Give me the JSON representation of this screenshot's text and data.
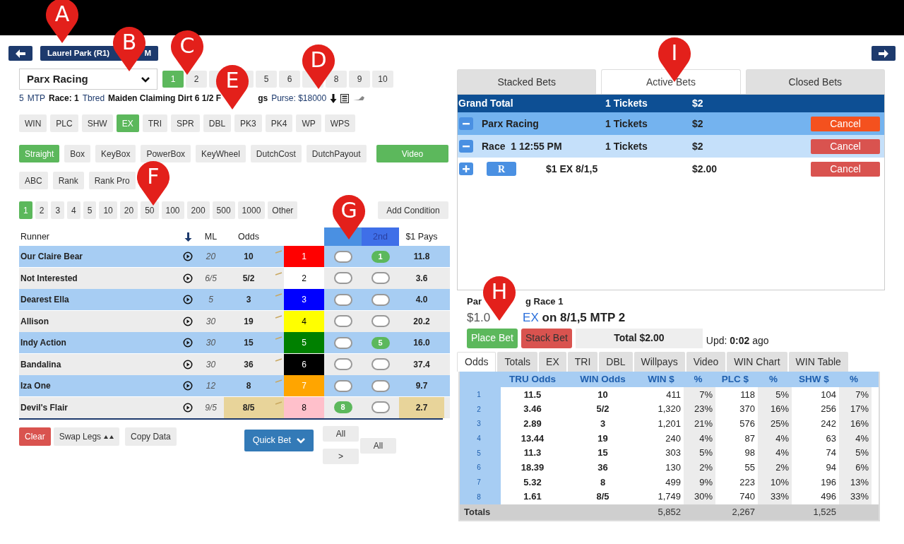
{
  "callouts": [
    {
      "letter": "A"
    },
    {
      "letter": "B"
    },
    {
      "letter": "C"
    },
    {
      "letter": "D"
    },
    {
      "letter": "E"
    },
    {
      "letter": "F"
    },
    {
      "letter": "G"
    },
    {
      "letter": "H"
    },
    {
      "letter": "I"
    }
  ],
  "race_button": {
    "label": "Laurel Park (R1)",
    "tail": "M"
  },
  "track_select": {
    "value": "Parx Racing"
  },
  "races": [
    {
      "kind": "number",
      "label": "1",
      "selected": true
    },
    {
      "kind": "number",
      "label": "2",
      "selected": false
    },
    {
      "kind": "covered",
      "selected": false
    },
    {
      "kind": "covered",
      "selected": false
    },
    {
      "kind": "number",
      "label": "5",
      "selected": false
    },
    {
      "kind": "number",
      "label": "6",
      "selected": false
    },
    {
      "kind": "covered",
      "selected": false
    },
    {
      "kind": "number",
      "label": "8",
      "selected": false
    },
    {
      "kind": "number",
      "label": "9",
      "selected": false
    },
    {
      "kind": "number",
      "label": "10",
      "selected": false
    }
  ],
  "race_info": [
    {
      "text": "5",
      "bold": false
    },
    {
      "text": "MTP",
      "bold": false
    },
    {
      "text": "Race: 1",
      "bold": true
    },
    {
      "text": "Tbred",
      "bold": false
    },
    {
      "text": "Maiden Claiming Dirt 6 1/2 F",
      "bold": true
    }
  ],
  "race_info_after": [
    {
      "text": "gs",
      "bold": true
    },
    {
      "text": "Purse: $18000",
      "bold": false
    }
  ],
  "bet_types": [
    {
      "label": "WIN",
      "selected": false
    },
    {
      "label": "PLC",
      "selected": false
    },
    {
      "label": "SHW",
      "selected": false
    },
    {
      "label": "EX",
      "selected": true
    },
    {
      "label": "TRI",
      "selected": false
    },
    {
      "label": "SPR",
      "selected": false
    },
    {
      "label": "DBL",
      "selected": false
    },
    {
      "label": "PK3",
      "selected": false
    },
    {
      "label": "PK4",
      "selected": false
    },
    {
      "label": "WP",
      "selected": false
    },
    {
      "label": "WPS",
      "selected": false
    }
  ],
  "bet_modes": [
    {
      "label": "Straight",
      "selected": true
    },
    {
      "label": "Box",
      "selected": false
    },
    {
      "label": "KeyBox",
      "selected": false
    },
    {
      "label": "PowerBox",
      "selected": false
    },
    {
      "label": "KeyWheel",
      "selected": false
    },
    {
      "label": "DutchCost",
      "selected": false
    },
    {
      "label": "DutchPayout",
      "selected": false
    }
  ],
  "video_button": "Video",
  "rank_modes": [
    "ABC",
    "Rank",
    "Rank Pro"
  ],
  "amounts": [
    {
      "label": "1",
      "selected": true
    },
    {
      "label": "2",
      "selected": false
    },
    {
      "label": "3",
      "selected": false
    },
    {
      "label": "4",
      "selected": false
    },
    {
      "label": "5",
      "selected": false
    },
    {
      "label": "10",
      "selected": false
    },
    {
      "label": "20",
      "selected": false
    },
    {
      "label": "50",
      "selected": false
    },
    {
      "label": "100",
      "selected": false
    },
    {
      "label": "200",
      "selected": false
    },
    {
      "label": "500",
      "selected": false
    },
    {
      "label": "1000",
      "selected": false
    },
    {
      "label": "Other",
      "selected": false
    }
  ],
  "add_condition": "Add Condition",
  "runners_table": {
    "headers": {
      "runner": "Runner",
      "ml": "ML",
      "odds": "Odds",
      "second": "2nd",
      "pays": "$1 Pays"
    },
    "rows": [
      {
        "name": "Our Claire Bear",
        "ml": "20",
        "odds": "10",
        "number": "1",
        "color": "#ff0000",
        "first": {
          "selected": false
        },
        "second": {
          "selected": true,
          "label": "1"
        },
        "pays": "11.8",
        "favorite": false
      },
      {
        "name": "Not Interested",
        "ml": "6/5",
        "odds": "5/2",
        "number": "2",
        "color": "#ffffff",
        "first": {
          "selected": false
        },
        "second": {
          "selected": false
        },
        "pays": "3.6",
        "favorite": false
      },
      {
        "name": "Dearest Ella",
        "ml": "5",
        "odds": "3",
        "number": "3",
        "color": "#0000ff",
        "first": {
          "selected": false
        },
        "second": {
          "selected": false
        },
        "pays": "4.0",
        "favorite": false
      },
      {
        "name": "Allison",
        "ml": "30",
        "odds": "19",
        "number": "4",
        "color": "#ffff00",
        "first": {
          "selected": false
        },
        "second": {
          "selected": false
        },
        "pays": "20.2",
        "favorite": false
      },
      {
        "name": "Indy Action",
        "ml": "30",
        "odds": "15",
        "number": "5",
        "color": "#008000",
        "first": {
          "selected": false
        },
        "second": {
          "selected": true,
          "label": "5"
        },
        "pays": "16.0",
        "favorite": false
      },
      {
        "name": "Bandalina",
        "ml": "30",
        "odds": "36",
        "number": "6",
        "color": "#000000",
        "first": {
          "selected": false
        },
        "second": {
          "selected": false
        },
        "pays": "37.4",
        "favorite": false
      },
      {
        "name": "Iza One",
        "ml": "12",
        "odds": "8",
        "number": "7",
        "color": "#ffa500",
        "first": {
          "selected": false
        },
        "second": {
          "selected": false
        },
        "pays": "9.7",
        "favorite": false
      },
      {
        "name": "Devil's Flair",
        "ml": "9/5",
        "odds": "8/5",
        "number": "8",
        "color": "#ffc0cb",
        "first": {
          "selected": true,
          "label": "8"
        },
        "second": {
          "selected": false
        },
        "pays": "2.7",
        "favorite": true
      }
    ]
  },
  "actions": {
    "clear": "Clear",
    "swap": "Swap Legs",
    "copy": "Copy Data",
    "quick_bet": "Quick Bet",
    "all_first": "All",
    "next": ">",
    "all_second": "All"
  },
  "bet_tabs": [
    {
      "label": "Stacked Bets",
      "selected": false
    },
    {
      "label": "Active Bets",
      "selected": true
    },
    {
      "label": "Closed Bets",
      "selected": false
    }
  ],
  "bets": [
    {
      "kind": "grand",
      "name": "Grand Total",
      "tickets": "1 Tickets",
      "amount": "$2"
    },
    {
      "kind": "track",
      "name": "Parx Racing",
      "tickets": "1 Tickets",
      "amount": "$2",
      "expanded": true,
      "cancel": "Cancel",
      "hover": true
    },
    {
      "kind": "race",
      "name": "Race  1 12:55 PM",
      "tickets": "1 Tickets",
      "amount": "$2",
      "expanded": true,
      "cancel": "Cancel",
      "hover": false
    },
    {
      "kind": "ticket",
      "badge": "R",
      "name": "$1 EX 8/1,5",
      "amount": "$2.00",
      "expanded": false,
      "cancel": "Cancel",
      "hover": false
    }
  ],
  "slip": {
    "title_start": "Par",
    "title_end": "g Race 1",
    "amount": "$1.0",
    "type": "EX",
    "detail": "on 8/1,5 MTP 2",
    "place": "Place Bet",
    "stack": "Stack Bet",
    "total": "Total $2.00",
    "upd_label": "Upd:",
    "upd_value": "0:02",
    "upd_suffix": "ago"
  },
  "info_tabs": [
    {
      "label": "Odds",
      "selected": true
    },
    {
      "label": "Totals",
      "selected": false
    },
    {
      "label": "EX",
      "selected": false
    },
    {
      "label": "TRI",
      "selected": false
    },
    {
      "label": "DBL",
      "selected": false
    },
    {
      "label": "Willpays",
      "selected": false
    },
    {
      "label": "Video",
      "selected": false
    },
    {
      "label": "WIN Chart",
      "selected": false
    },
    {
      "label": "WIN Table",
      "selected": false
    }
  ],
  "odds_table": {
    "columns": [
      "TRU Odds",
      "WIN Odds",
      "WIN $",
      "%",
      "PLC $",
      "%",
      "SHW $",
      "%"
    ],
    "rows": [
      {
        "number": "1",
        "cells": [
          "11.5",
          "10",
          "411",
          "7%",
          "118",
          "5%",
          "104",
          "7%"
        ]
      },
      {
        "number": "2",
        "cells": [
          "3.46",
          "5/2",
          "1,320",
          "23%",
          "370",
          "16%",
          "256",
          "17%"
        ]
      },
      {
        "number": "3",
        "cells": [
          "2.89",
          "3",
          "1,201",
          "21%",
          "576",
          "25%",
          "242",
          "16%"
        ]
      },
      {
        "number": "4",
        "cells": [
          "13.44",
          "19",
          "240",
          "4%",
          "87",
          "4%",
          "63",
          "4%"
        ]
      },
      {
        "number": "5",
        "cells": [
          "11.3",
          "15",
          "303",
          "5%",
          "98",
          "4%",
          "74",
          "5%"
        ]
      },
      {
        "number": "6",
        "cells": [
          "18.39",
          "36",
          "130",
          "2%",
          "55",
          "2%",
          "94",
          "6%"
        ]
      },
      {
        "number": "7",
        "cells": [
          "5.32",
          "8",
          "499",
          "9%",
          "223",
          "10%",
          "196",
          "13%"
        ]
      },
      {
        "number": "8",
        "cells": [
          "1.61",
          "8/5",
          "1,749",
          "30%",
          "740",
          "33%",
          "496",
          "33%"
        ]
      }
    ],
    "totals": {
      "label": "Totals",
      "win": "5,852",
      "plc": "2,267",
      "shw": "1,525"
    }
  }
}
